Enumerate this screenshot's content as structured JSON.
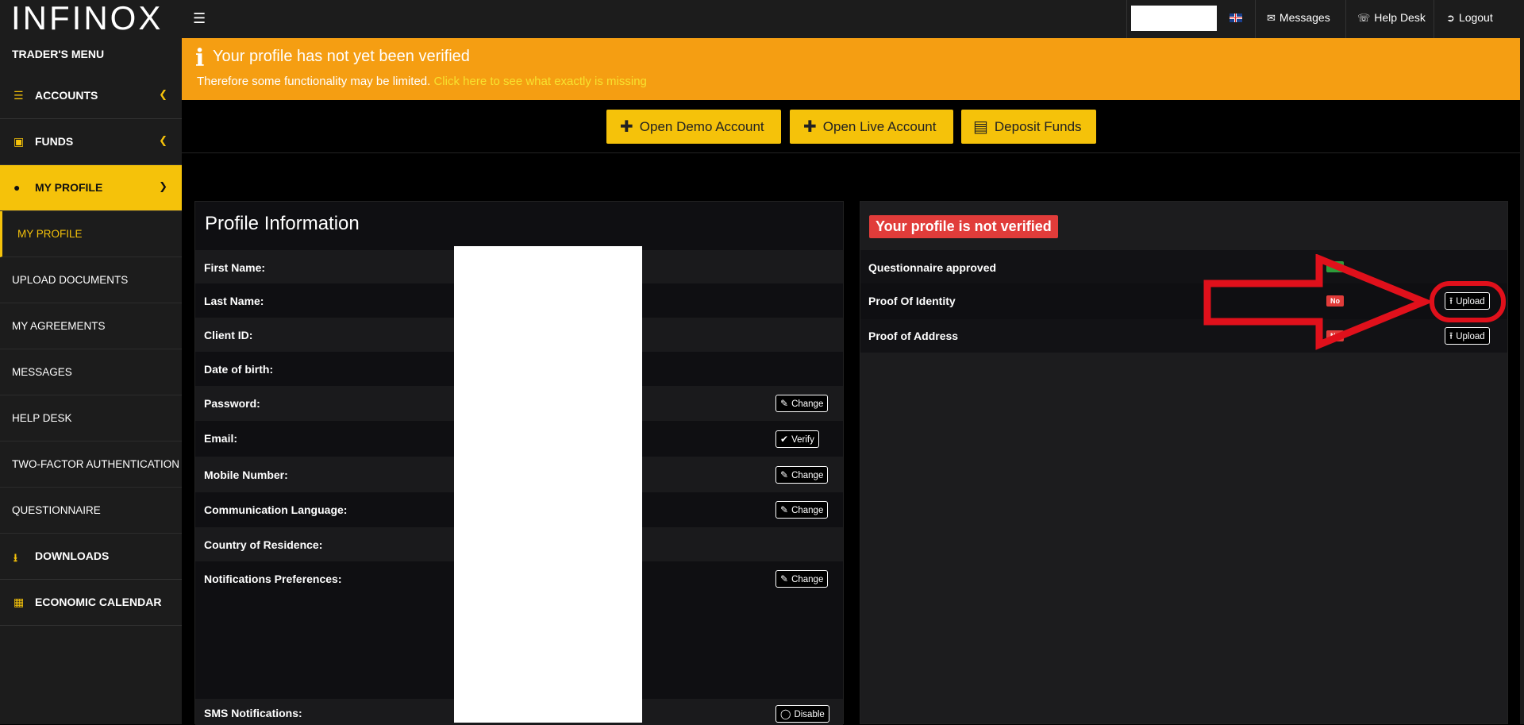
{
  "header": {
    "logo": "INFINOX",
    "messages_label": "Messages",
    "helpdesk_label": "Help Desk",
    "logout_label": "Logout"
  },
  "sidebar": {
    "header": "TRADER'S MENU",
    "items": [
      {
        "label": "ACCOUNTS"
      },
      {
        "label": "FUNDS"
      },
      {
        "label": "MY PROFILE"
      },
      {
        "label": "MY PROFILE"
      },
      {
        "label": "UPLOAD DOCUMENTS"
      },
      {
        "label": "MY AGREEMENTS"
      },
      {
        "label": "MESSAGES"
      },
      {
        "label": "HELP DESK"
      },
      {
        "label": "TWO-FACTOR AUTHENTICATION"
      },
      {
        "label": "QUESTIONNAIRE"
      },
      {
        "label": "DOWNLOADS"
      },
      {
        "label": "ECONOMIC CALENDAR"
      }
    ]
  },
  "banner": {
    "title": "Your profile has not yet been verified",
    "text": "Therefore some functionality may be limited.",
    "link": "Click here to see what exactly is missing"
  },
  "actions": {
    "demo": "Open Demo Account",
    "live": "Open Live Account",
    "deposit": "Deposit Funds"
  },
  "profile": {
    "title": "Profile Information",
    "rows": [
      {
        "label": "First Name:"
      },
      {
        "label": "Last Name:"
      },
      {
        "label": "Client ID:"
      },
      {
        "label": "Date of birth:"
      },
      {
        "label": "Password:",
        "button": "Change"
      },
      {
        "label": "Email:",
        "button": "Verify"
      },
      {
        "label": "Mobile Number:",
        "button": "Change"
      },
      {
        "label": "Communication Language:",
        "button": "Change"
      },
      {
        "label": "Country of Residence:"
      },
      {
        "label": "Notifications Preferences:",
        "button": "Change"
      },
      {
        "label": "SMS Notifications:",
        "button": "Disable"
      }
    ]
  },
  "verification": {
    "badge": "Your profile is not verified",
    "rows": [
      {
        "label": "Questionnaire approved",
        "status": ""
      },
      {
        "label": "Proof Of Identity",
        "status": "No",
        "button": "Upload"
      },
      {
        "label": "Proof of Address",
        "status": "No",
        "button": "Upload"
      }
    ]
  },
  "colors": {
    "accent": "#f5c20a",
    "banner": "#f59e12",
    "danger": "#e13c3a",
    "annotation": "#e0101b"
  }
}
